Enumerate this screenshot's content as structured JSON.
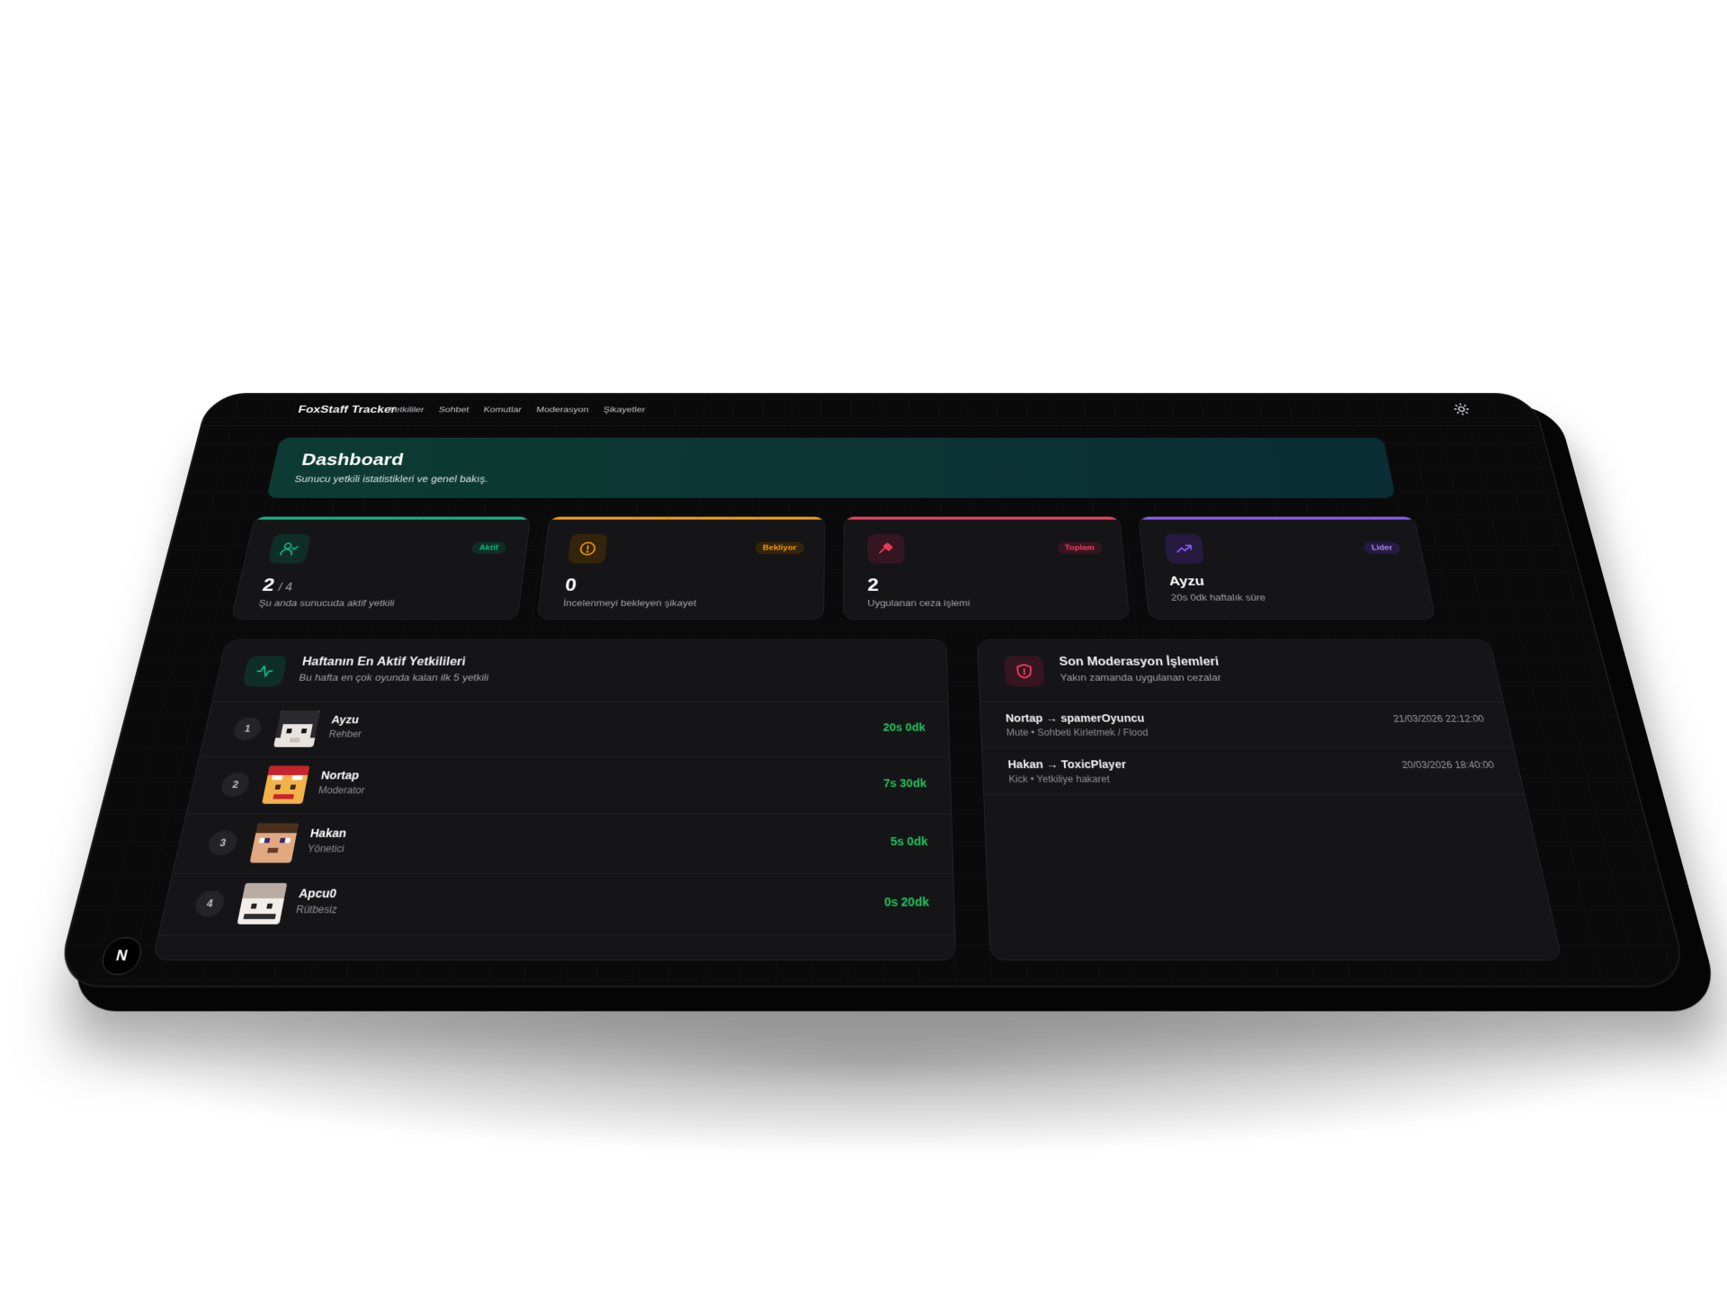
{
  "nav": {
    "brand": "FoxStaff Tracker",
    "links": [
      "Yetkililer",
      "Sohbet",
      "Komutlar",
      "Moderasyon",
      "Şikayetler"
    ],
    "theme_icon": "sun-icon"
  },
  "hero": {
    "title": "Dashboard",
    "subtitle": "Sunucu yetkili istatistikleri ve genel bakış."
  },
  "stats": [
    {
      "icon": "user-check-icon",
      "badge": "Aktif",
      "value": "2",
      "value_suffix": "/ 4",
      "caption": "Şu anda sunucuda aktif yetkili",
      "accent": "#10b981"
    },
    {
      "icon": "alert-circle-icon",
      "badge": "Bekliyor",
      "value": "0",
      "caption": "İncelenmeyi bekleyen şikayet",
      "accent": "#f59e0b"
    },
    {
      "icon": "gavel-icon",
      "badge": "Toplam",
      "value": "2",
      "caption": "Uygulanan ceza işlemi",
      "accent": "#f43f5e"
    },
    {
      "icon": "trending-up-icon",
      "badge": "Lider",
      "value": "Ayzu",
      "caption": "20s 0dk haftalık süre",
      "accent": "#8b5cf6"
    }
  ],
  "top_staff": {
    "icon": "activity-icon",
    "title": "Haftanın En Aktif Yetkilileri",
    "subtitle": "Bu hafta en çok oyunda kalan ilk 5 yetkili",
    "rows": [
      {
        "rank": "1",
        "name": "Ayzu",
        "role": "Rehber",
        "time": "20s 0dk"
      },
      {
        "rank": "2",
        "name": "Nortap",
        "role": "Moderator",
        "time": "7s 30dk"
      },
      {
        "rank": "3",
        "name": "Hakan",
        "role": "Yönetici",
        "time": "5s 0dk"
      },
      {
        "rank": "4",
        "name": "Apcu0",
        "role": "Rütbesiz",
        "time": "0s 20dk"
      }
    ]
  },
  "moderation": {
    "icon": "shield-icon",
    "title": "Son Moderasyon İşlemleri",
    "subtitle": "Yakın zamanda uygulanan cezalar",
    "rows": [
      {
        "title": "Nortap → spamerOyuncu",
        "detail": "Mute • Sohbeti Kirletmek / Flood",
        "date": "21/03/2026 22:12:00"
      },
      {
        "title": "Hakan → ToxicPlayer",
        "detail": "Kick • Yetkiliye hakaret",
        "date": "20/03/2026 18:40:00"
      }
    ]
  },
  "dev_badge": "N"
}
